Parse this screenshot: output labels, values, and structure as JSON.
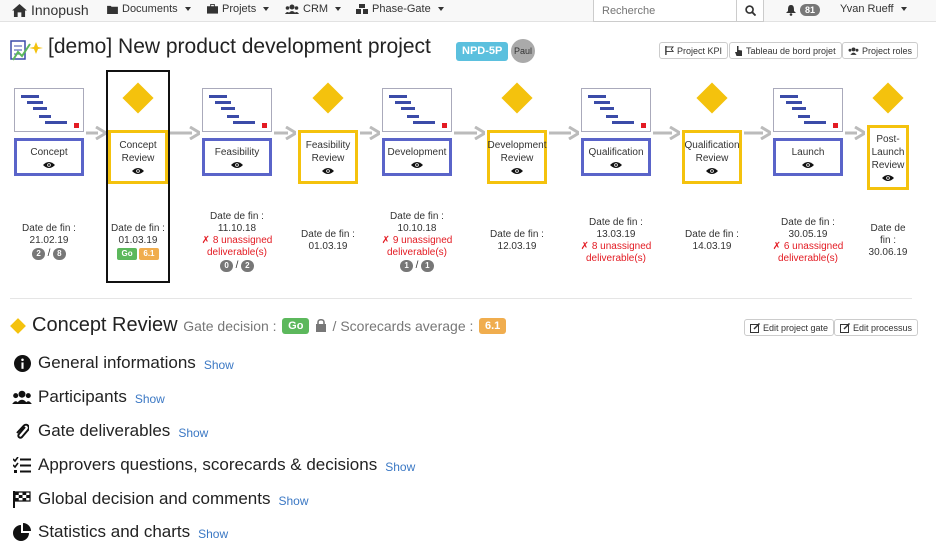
{
  "navbar": {
    "brand": "Innopush",
    "menus": [
      "Documents",
      "Projets",
      "CRM",
      "Phase-Gate"
    ],
    "search_placeholder": "Recherche",
    "notifications_count": "81",
    "user": "Yvan Rueff"
  },
  "project": {
    "title": "[demo] New product development project",
    "tag": "NPD-5P",
    "avatar": "Paul",
    "buttons": [
      "Project KPI",
      "Tableau de bord projet",
      "Project roles"
    ]
  },
  "stages": [
    {
      "type": "phase",
      "label": "Concept",
      "info": [
        "Date de fin :",
        "21.02.19"
      ],
      "counts": [
        "2",
        "8"
      ]
    },
    {
      "type": "gate",
      "label": "Concept Review",
      "info": [
        "Date de fin :",
        "01.03.19"
      ],
      "labels": [
        "Go",
        "6.1"
      ],
      "selected": true
    },
    {
      "type": "phase",
      "label": "Feasibility",
      "info": [
        "Date de fin :",
        "11.10.18"
      ],
      "warning": [
        "✗ 8 unassigned",
        "deliverable(s)"
      ],
      "counts": [
        "0",
        "2"
      ]
    },
    {
      "type": "gate",
      "label": "Feasibility Review",
      "info": [
        "Date de fin :",
        "01.03.19"
      ]
    },
    {
      "type": "phase",
      "label": "Development",
      "info": [
        "Date de fin :",
        "10.10.18"
      ],
      "warning": [
        "✗ 9 unassigned",
        "deliverable(s)"
      ],
      "counts": [
        "1",
        "1"
      ]
    },
    {
      "type": "gate",
      "label": "Development Review",
      "info": [
        "Date de fin :",
        "12.03.19"
      ]
    },
    {
      "type": "phase",
      "label": "Qualification",
      "info": [
        "Date de fin :",
        "13.03.19"
      ],
      "warning": [
        "✗ 8 unassigned",
        "deliverable(s)"
      ]
    },
    {
      "type": "gate",
      "label": "Qualification Review",
      "info": [
        "Date de fin :",
        "14.03.19"
      ]
    },
    {
      "type": "phase",
      "label": "Launch",
      "info": [
        "Date de fin :",
        "30.05.19"
      ],
      "warning": [
        "✗ 6 unassigned",
        "deliverable(s)"
      ]
    },
    {
      "type": "gate",
      "label": "Post-Launch Review",
      "info": [
        "Date de",
        "fin :",
        "30.06.19"
      ]
    }
  ],
  "gate_section": {
    "title": "Concept Review",
    "decision_label": "Gate decision :",
    "decision": "Go",
    "average_label": "/ Scorecards average :",
    "average": "6.1",
    "buttons": [
      "Edit project gate",
      "Edit processus"
    ]
  },
  "sections": [
    {
      "icon": "info-circle-icon",
      "title": "General informations",
      "action": "Show"
    },
    {
      "icon": "users-icon",
      "title": "Participants",
      "action": "Show"
    },
    {
      "icon": "paperclip-icon",
      "title": "Gate deliverables",
      "action": "Show"
    },
    {
      "icon": "list-check-icon",
      "title": "Approvers questions, scorecards & decisions",
      "action": "Show"
    },
    {
      "icon": "checkered-flag-icon",
      "title": "Global decision and comments",
      "action": "Show"
    },
    {
      "icon": "pie-chart-icon",
      "title": "Statistics and charts",
      "action": "Show"
    }
  ],
  "colors": {
    "phase_border": "#5a64c9",
    "gate": "#f4c20d",
    "go": "#5cb85c",
    "average": "#f0ad4e",
    "warning": "#e31b23",
    "tag": "#5bc0de"
  }
}
